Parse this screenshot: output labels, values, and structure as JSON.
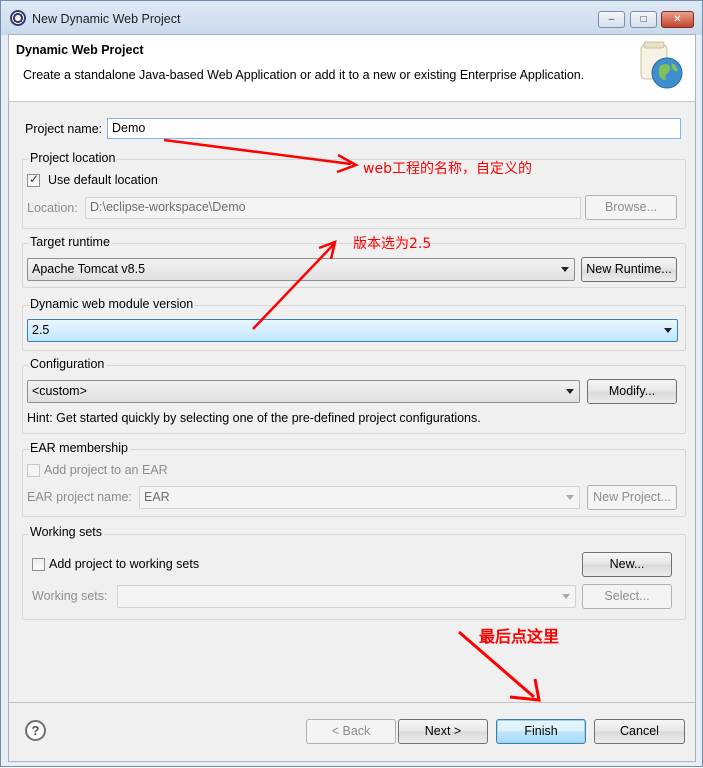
{
  "window": {
    "title": "New Dynamic Web Project",
    "header_title": "Dynamic Web Project",
    "header_description": "Create a standalone Java-based Web Application or add it to a new or existing Enterprise Application."
  },
  "project_name": {
    "label": "Project name:",
    "value": "Demo"
  },
  "project_location": {
    "group_label": "Project location",
    "use_default_label": "Use default location",
    "use_default_checked": true,
    "location_label": "Location:",
    "location_value": "D:\\eclipse-workspace\\Demo",
    "browse_label": "Browse..."
  },
  "target_runtime": {
    "group_label": "Target runtime",
    "value": "Apache Tomcat v8.5",
    "new_runtime_label": "New Runtime..."
  },
  "module_version": {
    "group_label": "Dynamic web module version",
    "value": "2.5"
  },
  "configuration": {
    "group_label": "Configuration",
    "value": "<custom>",
    "modify_label": "Modify...",
    "hint": "Hint: Get started quickly by selecting one of the pre-defined project configurations."
  },
  "ear": {
    "group_label": "EAR membership",
    "add_label": "Add project to an EAR",
    "project_name_label": "EAR project name:",
    "project_name_value": "EAR",
    "new_project_label": "New Project..."
  },
  "working_sets": {
    "group_label": "Working sets",
    "add_label": "Add project to working sets",
    "new_label": "New...",
    "sets_label": "Working sets:",
    "sets_value": "",
    "select_label": "Select..."
  },
  "annotations": {
    "name_note": "web工程的名称，自定义的",
    "version_note": "版本选为2.5",
    "finish_note": "最后点这里"
  },
  "footer": {
    "back_label": "< Back",
    "next_label": "Next >",
    "finish_label": "Finish",
    "cancel_label": "Cancel"
  },
  "colors": {
    "annotation": "#ff0000",
    "selection": "#bee6fd"
  }
}
